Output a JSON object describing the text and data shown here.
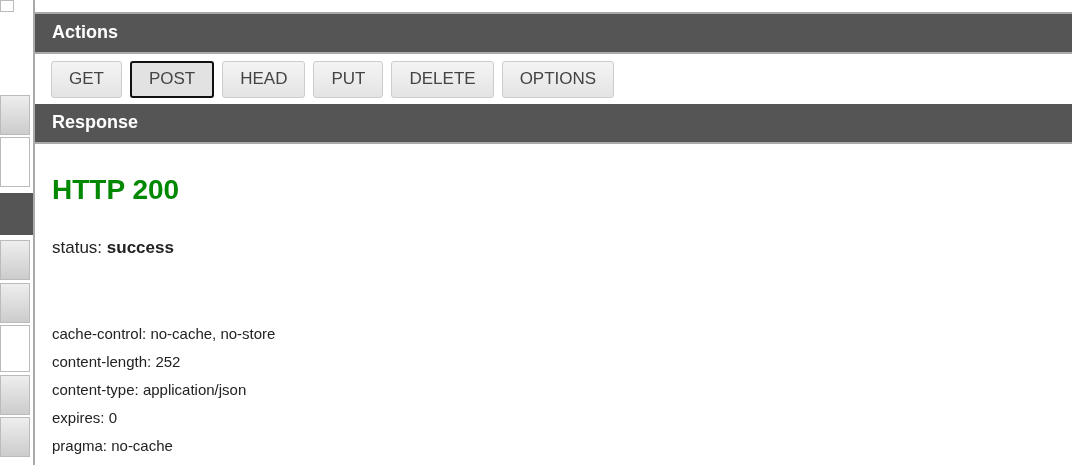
{
  "actions": {
    "title": "Actions",
    "buttons": [
      {
        "label": "GET",
        "selected": false
      },
      {
        "label": "POST",
        "selected": true
      },
      {
        "label": "HEAD",
        "selected": false
      },
      {
        "label": "PUT",
        "selected": false
      },
      {
        "label": "DELETE",
        "selected": false
      },
      {
        "label": "OPTIONS",
        "selected": false
      }
    ]
  },
  "response": {
    "title": "Response",
    "code": "HTTP 200",
    "status": "status: **success**",
    "headers": [
      "cache-control: no-cache, no-store",
      "content-length: 252",
      "content-type: application/json",
      "expires: 0",
      "pragma: no-cache"
    ]
  }
}
